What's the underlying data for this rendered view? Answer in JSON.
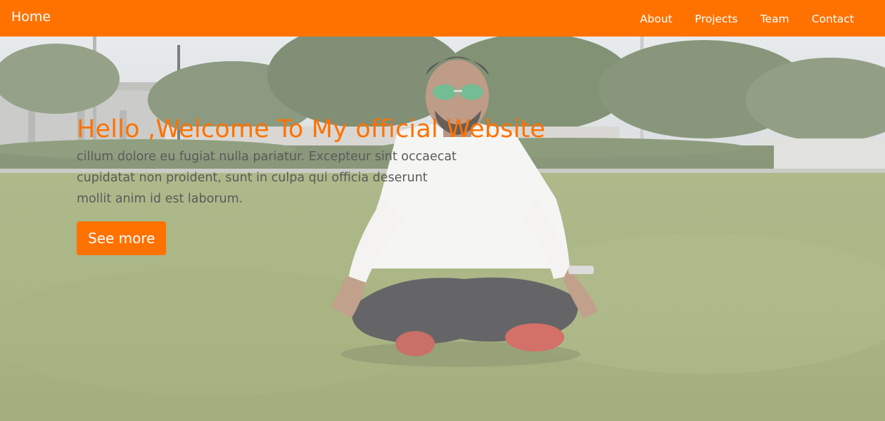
{
  "nav": {
    "brand": "Home",
    "links": [
      "About",
      "Projects",
      "Team",
      "Contact"
    ]
  },
  "hero": {
    "title": "Hello ,Welcome To My official Website",
    "text": "cillum dolore eu fugiat nulla pariatur. Excepteur sint occaecat cupidatat non proident, sunt in culpa qui officia deserunt mollit anim id est laborum.",
    "button_label": "See more"
  },
  "colors": {
    "accent": "#ff7200",
    "body_text": "#5a5a5a",
    "nav_text": "#ffffff"
  }
}
